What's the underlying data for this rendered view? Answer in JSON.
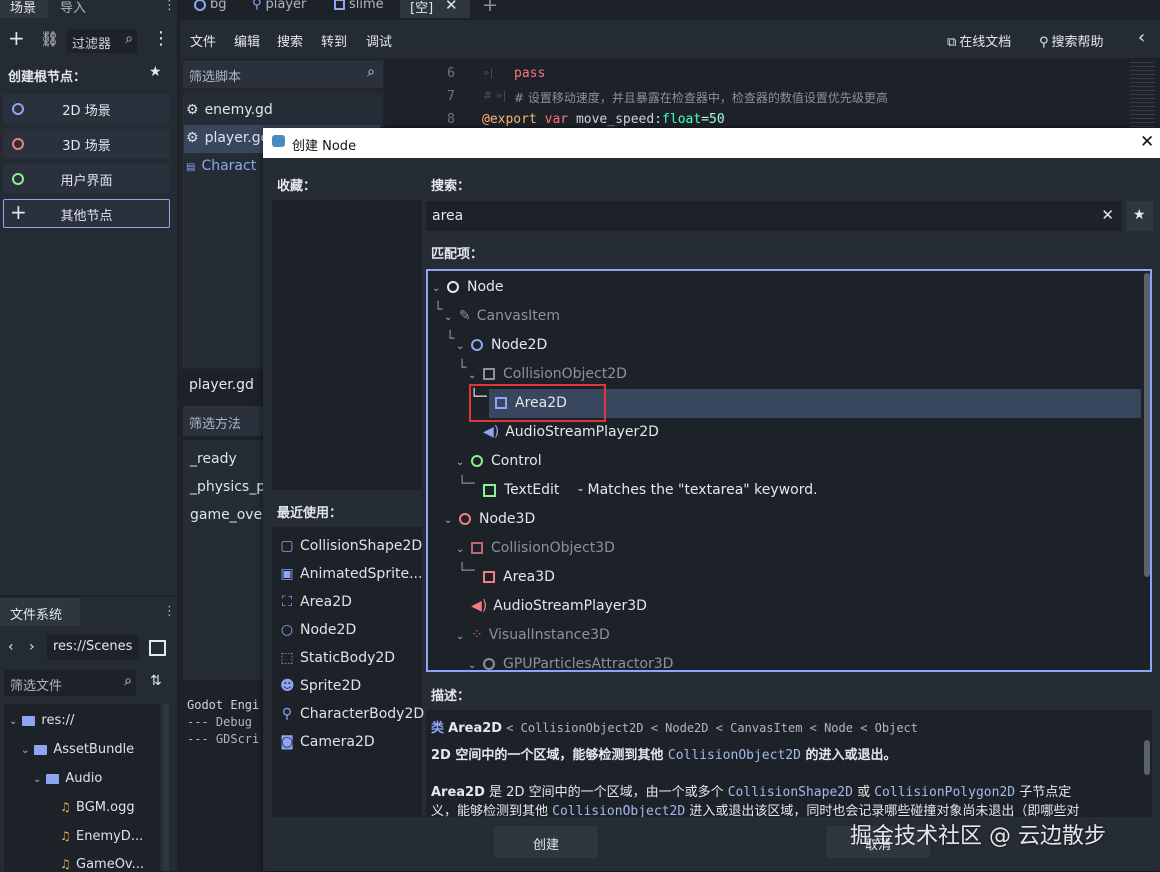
{
  "top_tabs": {
    "scene_tab": "场景",
    "import_tab": "导入",
    "editor_tabs": [
      "bg",
      "player",
      "slime",
      "[空]"
    ]
  },
  "scene_panel": {
    "filter_placeholder": "过滤器",
    "create_root_label": "创建根节点：",
    "buttons": [
      "2D 场景",
      "3D 场景",
      "用户界面",
      "其他节点"
    ]
  },
  "script_menu": {
    "items": [
      "文件",
      "编辑",
      "搜索",
      "转到",
      "调试"
    ],
    "online_docs": "在线文档",
    "search_help": "搜索帮助"
  },
  "script_list": {
    "filter_placeholder": "筛选脚本",
    "files": [
      "enemy.gd",
      "player.gd",
      "Charact"
    ],
    "current_file": "player.gd",
    "method_filter_placeholder": "筛选方法",
    "methods": [
      "_ready",
      "_physics_pr",
      "game_over"
    ]
  },
  "code": {
    "lines": [
      {
        "num": "6",
        "text": "pass"
      },
      {
        "num": "7",
        "text": "# 设置移动速度，并且暴露在检查器中，检查器的数值设置优先级更高"
      },
      {
        "num": "8",
        "kw": "@export",
        "var": "var",
        "name": "move_speed",
        "type": "float",
        "value": "=50"
      }
    ]
  },
  "output": {
    "lines": [
      "Godot Engi",
      "--- Debug",
      "--- GDScri"
    ]
  },
  "filesystem": {
    "tab_label": "文件系统",
    "path": "res://Scenes",
    "filter_placeholder": "筛选文件",
    "tree": [
      "res://",
      "AssetBundle",
      "Audio",
      "BGM.ogg",
      "EnemyD...",
      "GameOv..."
    ]
  },
  "dialog": {
    "title": "创建 Node",
    "favorites_label": "收藏：",
    "recent_label": "最近使用：",
    "recent_items": [
      "CollisionShape2D",
      "AnimatedSprite...",
      "Area2D",
      "Node2D",
      "StaticBody2D",
      "Sprite2D",
      "CharacterBody2D",
      "Camera2D"
    ],
    "search_label": "搜索：",
    "search_value": "area",
    "matches_label": "匹配项：",
    "tree": {
      "node": "Node",
      "canvas_item": "CanvasItem",
      "node2d": "Node2D",
      "collision_object_2d": "CollisionObject2D",
      "area2d": "Area2D",
      "audio_stream_player_2d": "AudioStreamPlayer2D",
      "control": "Control",
      "text_edit": "TextEdit",
      "text_edit_note": "- Matches the \"textarea\" keyword.",
      "node3d": "Node3D",
      "collision_object_3d": "CollisionObject3D",
      "area3d": "Area3D",
      "audio_stream_player_3d": "AudioStreamPlayer3D",
      "visual_instance_3d": "VisualInstance3D",
      "gpu_particles_attractor_3d": "GPUParticlesAttractor3D"
    },
    "description_label": "描述：",
    "class_line": {
      "prefix": "类",
      "name": "Area2D",
      "inheritance": "< CollisionObject2D < Node2D < CanvasItem < Node < Object"
    },
    "desc_summary_a": "2D 空间中的一个区域，能够检测到其他 ",
    "desc_summary_code": "CollisionObject2D",
    "desc_summary_b": " 的进入或退出。",
    "desc_body_1a": "Area2D",
    "desc_body_1b": " 是 2D 空间中的一个区域，由一个或多个 ",
    "desc_body_code1": "CollisionShape2D",
    "desc_body_1c": " 或 ",
    "desc_body_code2": "CollisionPolygon2D",
    "desc_body_1d": " 子节点定",
    "desc_body_2a": "义，能够检测到其他 ",
    "desc_body_code3": "CollisionObject2D",
    "desc_body_2b": " 进入或退出该区域，同时也会记录哪些碰撞对象尚未退出（即哪些对",
    "create_button": "创建",
    "cancel_button": "取消"
  },
  "watermark": "掘金技术社区 @ 云边散步",
  "colors": {
    "accent": "#8da5f3",
    "highlight_box": "#e0353b",
    "selection": "#38475e",
    "panel": "#21262e",
    "dialog_bg": "#262c35"
  }
}
